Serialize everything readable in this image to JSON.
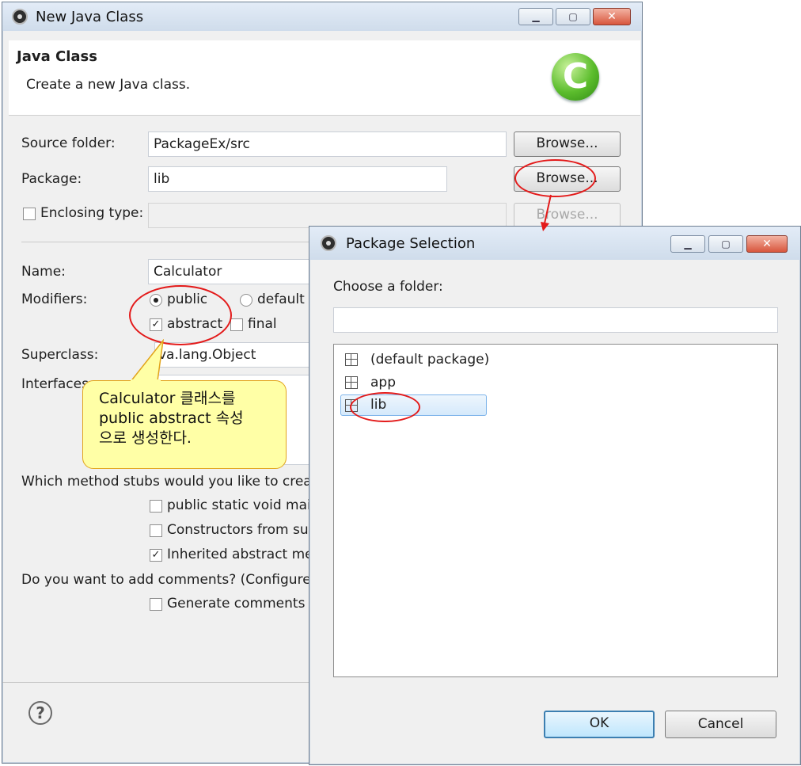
{
  "main_dialog": {
    "title": "New Java Class",
    "header_title": "Java Class",
    "header_desc": "Create a new Java class.",
    "logo_letter": "C",
    "source_folder_label": "Source folder:",
    "source_folder_value": "PackageEx/src",
    "package_label": "Package:",
    "package_value": "lib",
    "enclosing_label": "Enclosing type:",
    "browse_label": "Browse...",
    "name_label": "Name:",
    "name_value": "Calculator",
    "modifiers_label": "Modifiers:",
    "mod_public": "public",
    "mod_default": "default",
    "mod_abstract": "abstract",
    "mod_final": "final",
    "superclass_label": "Superclass:",
    "superclass_value": "va.lang.Object",
    "interfaces_label": "Interfaces:",
    "stubs_question": "Which method stubs would you like to create",
    "stub_main": "public static void main",
    "stub_constructors": "Constructors from sup",
    "stub_inherited": "Inherited abstract meth",
    "comments_question": "Do you want to add comments? (Configure t",
    "generate_comments": "Generate comments",
    "help_glyph": "?"
  },
  "package_dialog": {
    "title": "Package Selection",
    "choose_label": "Choose a folder:",
    "filter_value": "",
    "items": [
      "(default package)",
      "app",
      "lib"
    ],
    "ok_label": "OK",
    "cancel_label": "Cancel"
  },
  "window_controls": {
    "minimize": "▁",
    "maximize": "▢",
    "close": "✕"
  },
  "annotation": {
    "line1": "Calculator 클래스를",
    "line2": "public abstract 속성",
    "line3": "으로 생성한다."
  },
  "colors": {
    "highlight": "#e31a1a",
    "callout_fill": "#ffffa6",
    "logo_green": "#5cbd2d"
  }
}
